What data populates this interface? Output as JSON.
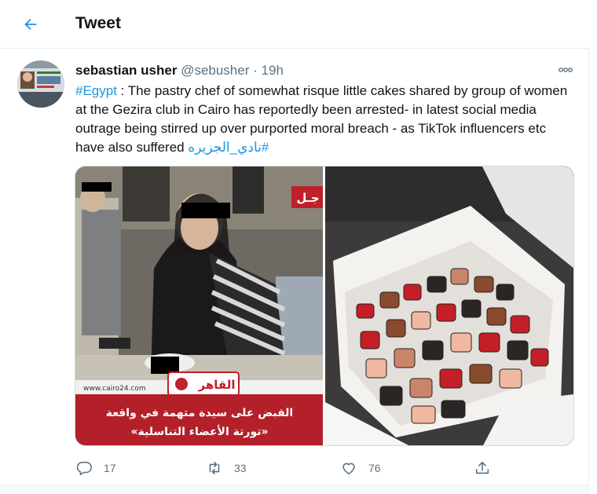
{
  "header": {
    "title": "Tweet"
  },
  "tweet": {
    "author_name": "sebastian usher",
    "author_handle": "@sebusher",
    "separator": "·",
    "time": "19h",
    "hashtag_egypt": "#Egypt",
    "text_main": " : The pastry chef of somewhat risque little cakes shared by group of women at the Gezira club in Cairo has reportedly been arrested- in latest social media outrage being stirred up over purported moral breach - as TikTok influencers etc have also suffered ",
    "hashtag_arabic": "#نادي_الجزيره",
    "media": [
      {
        "site": "www.cairo24.com",
        "logo_text": "القاهر",
        "corner_tag": "جـل",
        "caption_line1": "القبض على سيدة متهمة في واقعة",
        "caption_line2": "«تورتة الأعضاء التناسلية»"
      },
      {
        "description_alt": ""
      }
    ]
  },
  "actions": {
    "reply_count": "17",
    "retweet_count": "33",
    "like_count": "76"
  },
  "colors": {
    "accent": "#1b95e0",
    "icon_gray": "#5b7083",
    "banner_red": "#b3202a"
  }
}
